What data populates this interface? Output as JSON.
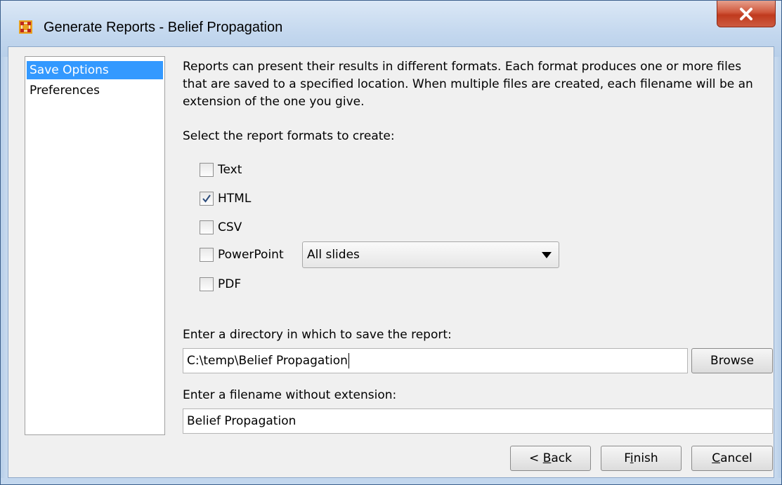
{
  "window": {
    "title": "Generate Reports - Belief Propagation",
    "close_label": "X"
  },
  "sidebar": {
    "items": [
      {
        "label": "Save Options",
        "selected": true
      },
      {
        "label": "Preferences",
        "selected": false
      }
    ]
  },
  "main": {
    "description": "Reports can present their results in different formats. Each format produces one or more files that are saved to a specified location. When multiple files are created, each filename will be an extension of the one you give.",
    "formats_prompt": "Select the report formats to create:",
    "formats": [
      {
        "label": "Text",
        "checked": false
      },
      {
        "label": "HTML",
        "checked": true
      },
      {
        "label": "CSV",
        "checked": false
      },
      {
        "label": "PowerPoint",
        "checked": false
      },
      {
        "label": "PDF",
        "checked": false
      }
    ],
    "powerpoint_option": "All slides",
    "directory_prompt": "Enter a directory in which to save the report:",
    "directory_value": "C:\\temp\\Belief Propagation",
    "browse_label": "Browse",
    "filename_prompt": "Enter a filename without extension:",
    "filename_value": "Belief Propagation"
  },
  "footer": {
    "back_prefix": "< ",
    "back_mnemonic": "B",
    "back_rest": "ack",
    "finish_pre": "F",
    "finish_mnemonic": "i",
    "finish_rest": "nish",
    "cancel_mnemonic": "C",
    "cancel_rest": "ancel"
  },
  "colors": {
    "selection": "#3399ff",
    "close_button": "#c8462a",
    "frame": "#c3d7ee"
  }
}
